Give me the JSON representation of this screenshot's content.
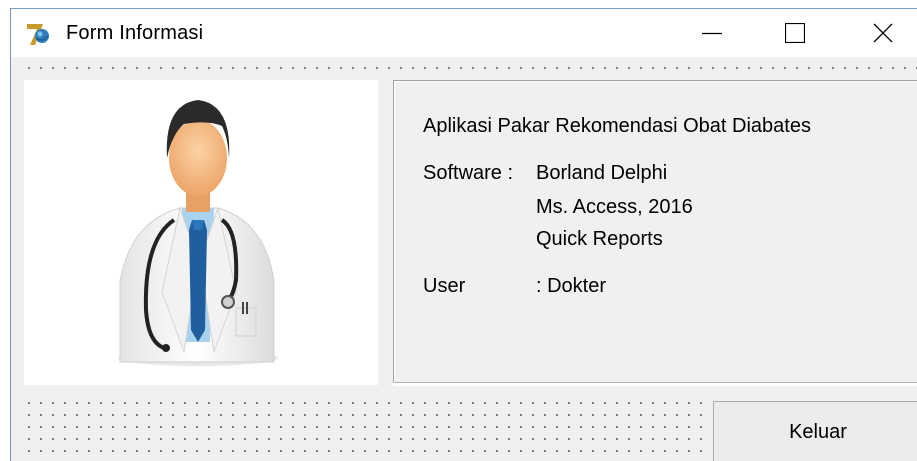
{
  "window": {
    "title": "Form Informasi",
    "icon": "delphi-app-icon",
    "controls": [
      "minimize-icon",
      "maximize-icon",
      "close-icon"
    ]
  },
  "image_panel": {
    "image": "doctor-illustration"
  },
  "info": {
    "app_title": "Aplikasi Pakar Rekomendasi Obat Diabates",
    "software_label": "Software :",
    "software_values": [
      "Borland Delphi",
      "Ms. Access, 2016",
      "Quick Reports"
    ],
    "user_label": "User",
    "user_value": ": Dokter"
  },
  "buttons": {
    "keluar": "Keluar"
  },
  "colors": {
    "form_background": "#f0f0f0",
    "titlebar": "#ffffff",
    "window_border": "#7a9bc4"
  }
}
